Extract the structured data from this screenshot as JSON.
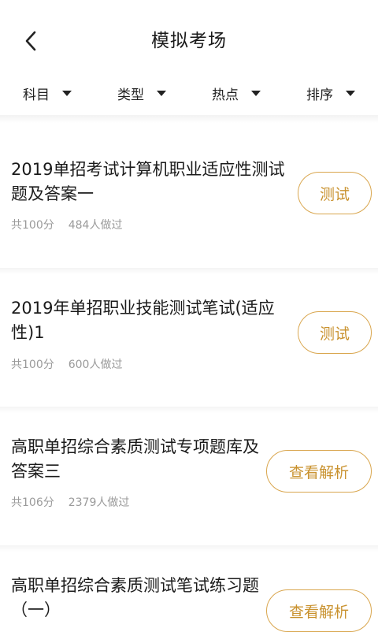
{
  "header": {
    "title": "模拟考场"
  },
  "filters": [
    {
      "label": "科目"
    },
    {
      "label": "类型"
    },
    {
      "label": "热点"
    },
    {
      "label": "排序"
    }
  ],
  "items": [
    {
      "title": "2019单招考试计算机职业适应性测试题及答案一",
      "score": "共100分",
      "takers": "484人做过",
      "action": "测试"
    },
    {
      "title": "2019年单招职业技能测试笔试(适应性)1",
      "score": "共100分",
      "takers": "600人做过",
      "action": "测试"
    },
    {
      "title": "高职单招综合素质测试专项题库及答案三",
      "score": "共106分",
      "takers": "2379人做过",
      "action": "查看解析"
    },
    {
      "title": "高职单招综合素质测试笔试练习题（一）",
      "score": "",
      "takers": "",
      "action": "查看解析"
    }
  ],
  "colors": {
    "accent": "#d9a64e",
    "accent_text": "#c9922f",
    "meta_text": "#9a9a9a"
  }
}
